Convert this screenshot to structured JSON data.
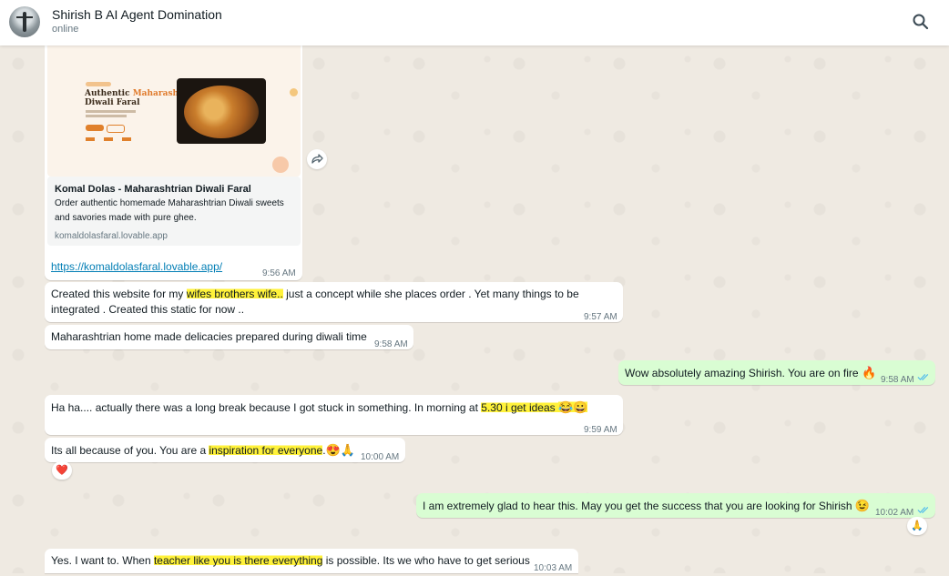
{
  "header": {
    "contact_name": "Shirish B AI Agent Domination",
    "status": "online",
    "icons": [
      "avatar",
      "search-icon"
    ]
  },
  "colors": {
    "incoming_bubble": "#ffffff",
    "outgoing_bubble": "#d9fdd3",
    "highlight": "#fff23a",
    "read_ticks": "#53bdeb",
    "link": "#027eb5"
  },
  "link_preview": {
    "image_heading_1": "Authentic",
    "image_heading_accent": "Maharashtrian",
    "image_heading_2": "Diwali Faral",
    "title": "Komal Dolas - Maharashtrian Diwali Faral",
    "description": "Order authentic homemade Maharashtrian Diwali sweets and savories made with pure ghee.",
    "domain": "komaldolasfaral.lovable.app",
    "url": "https://komaldolasfaral.lovable.app/",
    "time": "9:56 AM"
  },
  "messages": [
    {
      "id": "m1",
      "direction": "in",
      "parts": [
        "Created this website for my ",
        "wifes  brothers wife..",
        " just a concept while she places order . Yet many things to be"
      ],
      "line2": "integrated . Created this static for now ..",
      "time": "9:57 AM"
    },
    {
      "id": "m2",
      "direction": "in",
      "text": "Maharashtrian home made delicacies prepared during diwali time",
      "time": "9:58 AM"
    },
    {
      "id": "m3",
      "direction": "out",
      "text": "Wow absolutely amazing Shirish. You are on fire",
      "emoji": "🔥",
      "time": "9:58 AM",
      "status": "read"
    },
    {
      "id": "m4",
      "direction": "in",
      "parts": [
        "Ha ha.... actually there was a long break because I got stuck in something. In morning at ",
        "5.30 i get ideas "
      ],
      "emoji": "😂😀",
      "time": "9:59 AM"
    },
    {
      "id": "m5",
      "direction": "in",
      "parts": [
        "Its all because of you. You are a ",
        "inspiration for everyone",
        "."
      ],
      "emoji": "😍🙏",
      "time": "10:00 AM",
      "reaction": "❤️"
    },
    {
      "id": "m6",
      "direction": "out",
      "text": "I am extremely glad to hear this. May you get the success that you are looking for Shirish",
      "emoji": "😉",
      "time": "10:02 AM",
      "status": "read",
      "reaction": "🙏"
    },
    {
      "id": "m7",
      "direction": "in",
      "parts": [
        "Yes. I want to. When ",
        "teacher like you is there everything",
        " is possible. Its we who have to get serious"
      ],
      "time": "10:03 AM"
    }
  ]
}
